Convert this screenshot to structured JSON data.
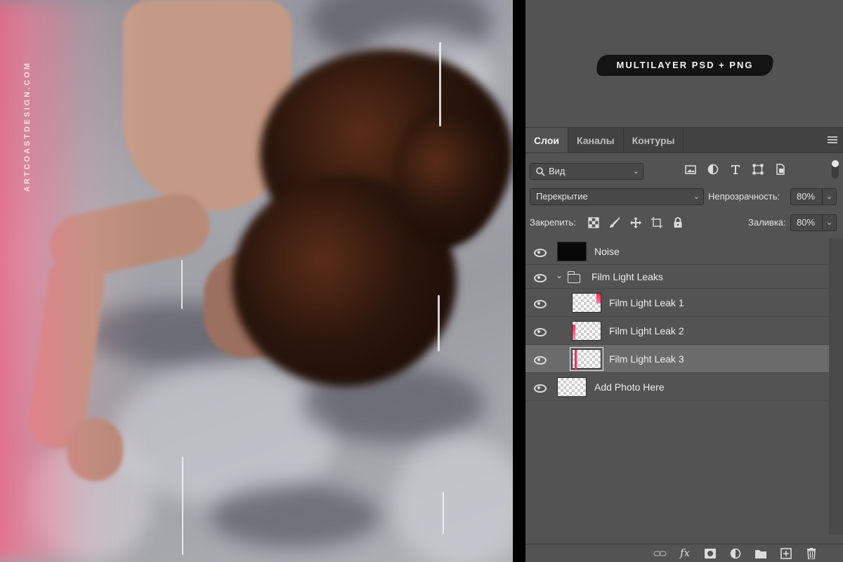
{
  "photo": {
    "watermark": "ARTCOASTDESIGN.COM"
  },
  "badge": {
    "text": "MULTILAYER PSD + PNG"
  },
  "layers_panel": {
    "tabs": [
      {
        "label": "Слои",
        "active": true
      },
      {
        "label": "Каналы",
        "active": false
      },
      {
        "label": "Контуры",
        "active": false
      }
    ],
    "filter": {
      "kind_label": "Вид"
    },
    "blend_mode": "Перекрытие",
    "opacity_label": "Непрозрачность:",
    "opacity_value": "80%",
    "lock_label": "Закрепить:",
    "fill_label": "Заливка:",
    "fill_value": "80%",
    "layers": [
      {
        "name": "Noise",
        "visible": true,
        "thumb": "black"
      },
      {
        "name": "Film Light Leaks",
        "visible": true,
        "type": "group",
        "expanded": true
      },
      {
        "name": "Film Light Leak 1",
        "visible": true,
        "indent": true
      },
      {
        "name": "Film Light Leak 2",
        "visible": true,
        "indent": true
      },
      {
        "name": "Film Light Leak 3",
        "visible": true,
        "indent": true,
        "selected": true
      },
      {
        "name": "Add Photo Here",
        "visible": true
      }
    ]
  },
  "colors": {
    "panel_bg": "#535353",
    "selected_row": "#6b6b6b",
    "leak_accent": "#ff3c6e"
  }
}
